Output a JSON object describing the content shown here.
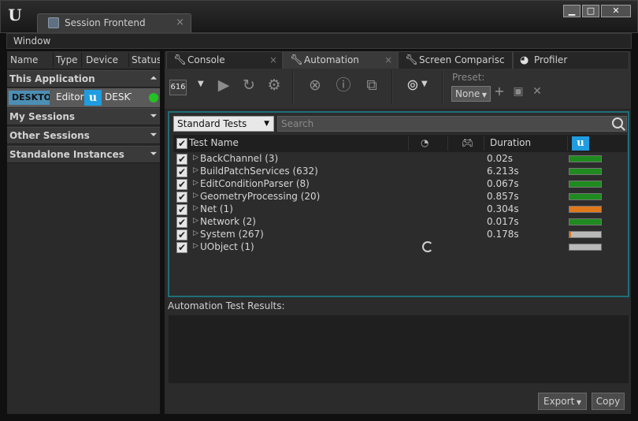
{
  "window": {
    "logo": "U",
    "tab_title": "Session Frontend",
    "tab_close": "×",
    "controls": {
      "minimize": "▁",
      "maximize": "□",
      "close": "✕"
    }
  },
  "menu": {
    "items": [
      "Window"
    ]
  },
  "sessions": {
    "columns": [
      "Name",
      "Type",
      "Device",
      "Status"
    ],
    "sections": [
      {
        "label": "This Application",
        "arrow": "⏶"
      },
      {
        "label": "My Sessions",
        "arrow": "⏷"
      },
      {
        "label": "Other Sessions",
        "arrow": "⏷"
      },
      {
        "label": "Standalone Instances",
        "arrow": "⏷"
      }
    ],
    "selected_row": {
      "name": "DESKTO",
      "type": "Editor",
      "device": "DESKT",
      "status_color": "#22c222"
    }
  },
  "tabs": [
    {
      "label": "Console",
      "icon": "wrench-icon",
      "close": "×"
    },
    {
      "label": "Automation",
      "icon": "wrench-icon",
      "close": "×",
      "active": true
    },
    {
      "label": "Screen Comparisc",
      "icon": "wrench-icon",
      "close": "×"
    },
    {
      "label": "Profiler",
      "icon": "pie-chart-icon",
      "close": ""
    }
  ],
  "toolbar": {
    "counter": "616",
    "preset_label": "Preset:",
    "preset_value": "None"
  },
  "filter": {
    "group_value": "Standard Tests",
    "search_placeholder": "Search"
  },
  "table": {
    "columns": [
      "Test Name",
      "Duration"
    ],
    "rows": [
      {
        "name": "BackChannel (3)",
        "duration": "0.02s",
        "progress": 1.0,
        "color": "#1f8a1f",
        "running": false
      },
      {
        "name": "BuildPatchServices (632)",
        "duration": "6.213s",
        "progress": 1.0,
        "color": "#1f8a1f",
        "running": false
      },
      {
        "name": "EditConditionParser (8)",
        "duration": "0.067s",
        "progress": 1.0,
        "color": "#1f8a1f",
        "running": false
      },
      {
        "name": "GeometryProcessing (20)",
        "duration": "0.857s",
        "progress": 1.0,
        "color": "#1f8a1f",
        "running": false
      },
      {
        "name": "Net (1)",
        "duration": "0.304s",
        "progress": 1.0,
        "color": "#e0781c",
        "running": false
      },
      {
        "name": "Network (2)",
        "duration": "0.017s",
        "progress": 1.0,
        "color": "#1f8a1f",
        "running": false
      },
      {
        "name": "System (267)",
        "duration": "0.178s",
        "progress": 0.05,
        "color": "#e0781c",
        "running": false
      },
      {
        "name": "UObject (1)",
        "duration": "",
        "progress": 0.0,
        "color": "#1f8a1f",
        "running": true
      }
    ]
  },
  "results": {
    "label": "Automation Test Results:"
  },
  "footer": {
    "export_label": "Export",
    "copy_label": "Copy"
  }
}
